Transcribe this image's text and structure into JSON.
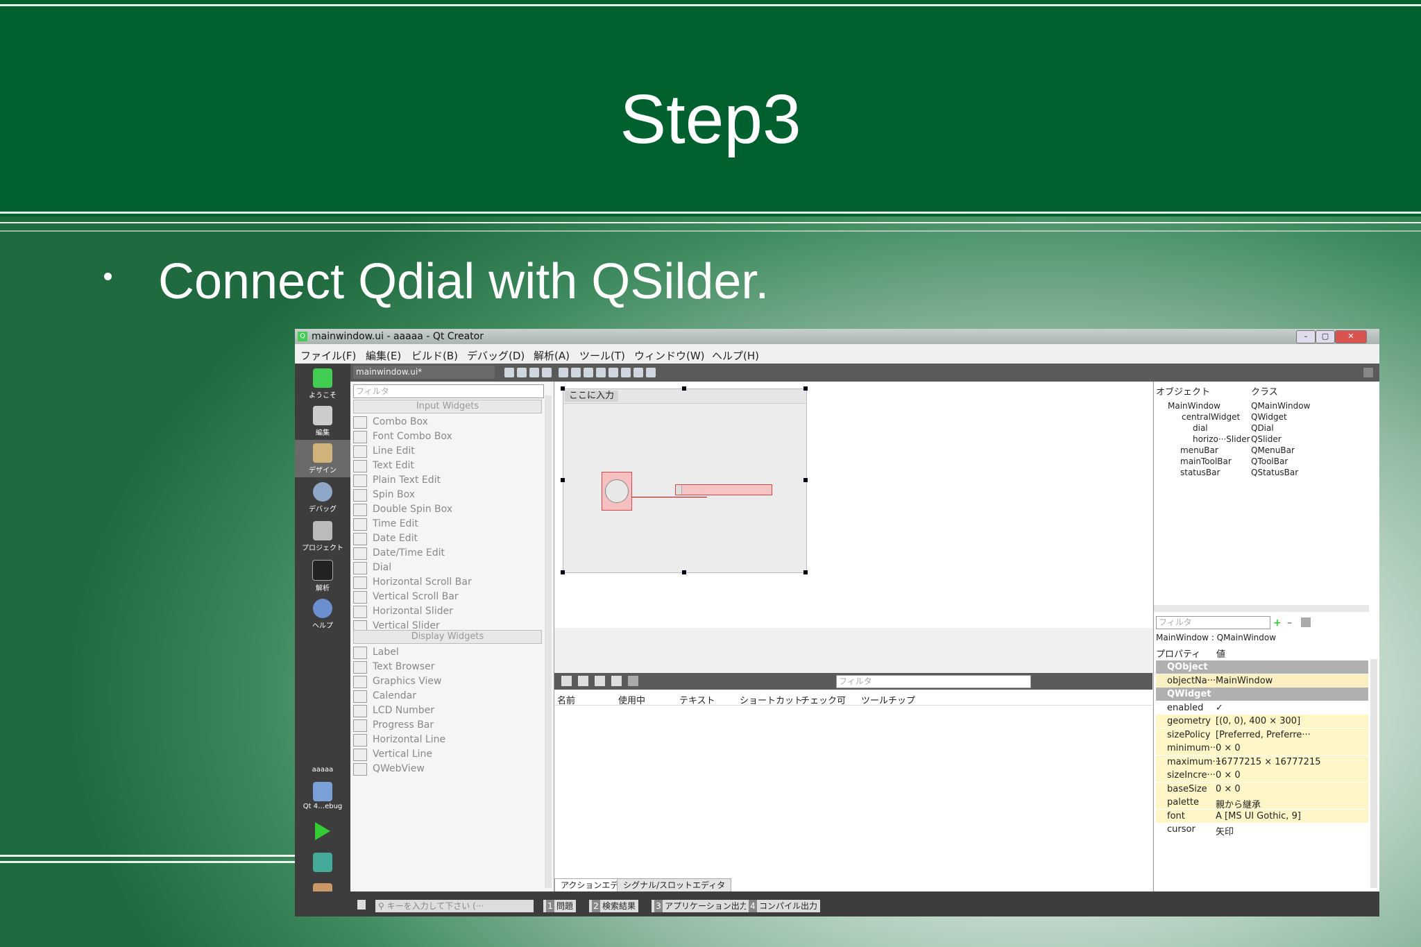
{
  "slide": {
    "title": "Step3",
    "bullet": "Connect Qdial with QSilder."
  },
  "window": {
    "title": "mainwindow.ui - aaaaa - Qt Creator",
    "menu": [
      "ファイル(F)",
      "編集(E)",
      "ビルド(B)",
      "デバッグ(D)",
      "解析(A)",
      "ツール(T)",
      "ウィンドウ(W)",
      "ヘルプ(H)"
    ],
    "file_selector": "mainwindow.ui*"
  },
  "modes": [
    {
      "label": "ようこそ",
      "icon": "qt-logo-icon"
    },
    {
      "label": "編集",
      "icon": "edit-icon"
    },
    {
      "label": "デザイン",
      "icon": "design-icon"
    },
    {
      "label": "デバッグ",
      "icon": "debug-icon"
    },
    {
      "label": "プロジェクト",
      "icon": "project-icon"
    },
    {
      "label": "解析",
      "icon": "analyze-icon"
    },
    {
      "label": "ヘルプ",
      "icon": "help-icon"
    }
  ],
  "kit": {
    "project": "aaaaa",
    "label": "Qt 4…ebug"
  },
  "widget_box": {
    "filter_placeholder": "フィルタ",
    "input_header": "Input Widgets",
    "input_items": [
      "Combo Box",
      "Font Combo Box",
      "Line Edit",
      "Text Edit",
      "Plain Text Edit",
      "Spin Box",
      "Double Spin Box",
      "Time Edit",
      "Date Edit",
      "Date/Time Edit",
      "Dial",
      "Horizontal Scroll Bar",
      "Vertical Scroll Bar",
      "Horizontal Slider",
      "Vertical Slider"
    ],
    "display_header": "Display Widgets",
    "display_items": [
      "Label",
      "Text Browser",
      "Graphics View",
      "Calendar",
      "LCD Number",
      "Progress Bar",
      "Horizontal Line",
      "Vertical Line",
      "QWebView"
    ]
  },
  "form": {
    "menu_placeholder": "ここに入力"
  },
  "action_editor": {
    "filter_placeholder": "フィルタ",
    "columns": [
      "名前",
      "使用中",
      "テキスト",
      "ショートカット",
      "チェック可",
      "ツールチップ"
    ],
    "tabs": [
      "アクションエディタ",
      "シグナル/スロットエディタ"
    ]
  },
  "object_inspector": {
    "columns": [
      "オブジェクト",
      "クラス"
    ],
    "rows": [
      {
        "name": "MainWindow",
        "cls": "QMainWindow"
      },
      {
        "name": "centralWidget",
        "cls": "QWidget"
      },
      {
        "name": "dial",
        "cls": "QDial"
      },
      {
        "name": "horizo···Slider",
        "cls": "QSlider"
      },
      {
        "name": "menuBar",
        "cls": "QMenuBar"
      },
      {
        "name": "mainToolBar",
        "cls": "QToolBar"
      },
      {
        "name": "statusBar",
        "cls": "QStatusBar"
      }
    ]
  },
  "property_editor": {
    "filter_placeholder": "フィルタ",
    "context": "MainWindow : QMainWindow",
    "columns": [
      "プロパティ",
      "値"
    ],
    "rows": [
      {
        "name": "QObject",
        "value": ""
      },
      {
        "name": "objectNa···",
        "value": "MainWindow"
      },
      {
        "name": "QWidget",
        "value": ""
      },
      {
        "name": "enabled",
        "value": "✓"
      },
      {
        "name": "geometry",
        "value": "[(0, 0), 400 × 300]"
      },
      {
        "name": "sizePolicy",
        "value": "[Preferred, Preferre···"
      },
      {
        "name": "minimum···",
        "value": "0 × 0"
      },
      {
        "name": "maximum···",
        "value": "16777215 × 16777215"
      },
      {
        "name": "sizeIncre···",
        "value": "0 × 0"
      },
      {
        "name": "baseSize",
        "value": "0 × 0"
      },
      {
        "name": "palette",
        "value": "親から継承"
      },
      {
        "name": "font",
        "value": "A  [MS UI Gothic, 9]"
      },
      {
        "name": "cursor",
        "value": "矢印"
      }
    ]
  },
  "statusbar": {
    "locator_placeholder": "キーを入力して下さい (···",
    "panes": [
      {
        "num": "1",
        "label": "問題"
      },
      {
        "num": "2",
        "label": "検索結果"
      },
      {
        "num": "3",
        "label": "アプリケーション出力"
      },
      {
        "num": "4",
        "label": "コンパイル出力"
      }
    ]
  },
  "colors": {
    "banner": "#00612f",
    "selection": "#d44444",
    "property_highlight": "#fff6c8"
  }
}
